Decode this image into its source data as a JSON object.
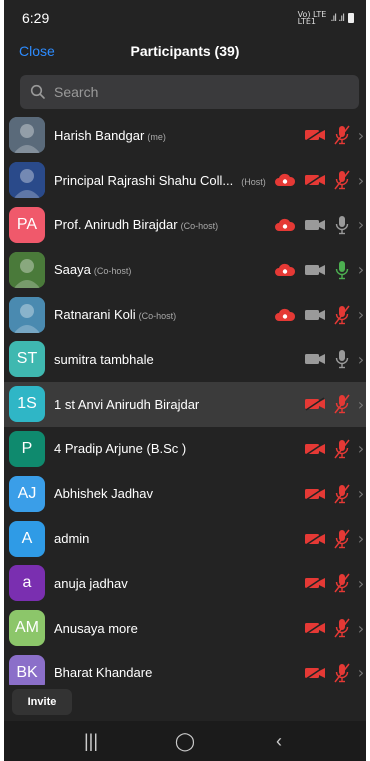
{
  "status": {
    "time": "6:29",
    "network": "Vo) LTE\nLTE1"
  },
  "header": {
    "close_label": "Close",
    "title": "Participants (39)"
  },
  "search": {
    "placeholder": "Search"
  },
  "colors": {
    "accent": "#2d8cff",
    "muted_red": "#e53935",
    "mic_green": "#4caf50"
  },
  "participants": [
    {
      "name": "Harish Bandgar",
      "tag": "(me)",
      "avatar_text": "",
      "avatar_color": "#5a6a7a",
      "avatar_photo": true,
      "cloud": false,
      "video": "off",
      "mic": "muted"
    },
    {
      "name": "Principal Rajrashi Shahu Coll...",
      "tag": "(Host)",
      "avatar_text": "",
      "avatar_color": "#2a4a8a",
      "avatar_photo": true,
      "cloud": true,
      "video": "off",
      "mic": "muted"
    },
    {
      "name": "Prof. Anirudh  Birajdar",
      "tag": "(Co-host)",
      "avatar_text": "PA",
      "avatar_color": "#f0596b",
      "avatar_photo": false,
      "cloud": true,
      "video": "on",
      "mic": "on"
    },
    {
      "name": "Saaya",
      "tag": "(Co-host)",
      "avatar_text": "",
      "avatar_color": "#4a7a3a",
      "avatar_photo": true,
      "cloud": true,
      "video": "on",
      "mic": "speaking"
    },
    {
      "name": "Ratnarani Koli",
      "tag": "(Co-host)",
      "avatar_text": "",
      "avatar_color": "#4a8ab0",
      "avatar_photo": true,
      "cloud": true,
      "video": "on",
      "mic": "muted"
    },
    {
      "name": "sumitra tambhale",
      "tag": "",
      "avatar_text": "ST",
      "avatar_color": "#3fb8b0",
      "avatar_photo": false,
      "cloud": false,
      "video": "on",
      "mic": "on"
    },
    {
      "name": "1 st Anvi Anirudh Birajdar",
      "tag": "",
      "avatar_text": "1S",
      "avatar_color": "#2fb6c6",
      "avatar_photo": false,
      "cloud": false,
      "video": "off",
      "mic": "muted"
    },
    {
      "name": "4 Pradip Arjune (B.Sc )",
      "tag": "",
      "avatar_text": "P",
      "avatar_color": "#0f8a6e",
      "avatar_photo": false,
      "cloud": false,
      "video": "off",
      "mic": "muted"
    },
    {
      "name": "Abhishek Jadhav",
      "tag": "",
      "avatar_text": "AJ",
      "avatar_color": "#3a9ee8",
      "avatar_photo": false,
      "cloud": false,
      "video": "off",
      "mic": "muted"
    },
    {
      "name": "admin",
      "tag": "",
      "avatar_text": "A",
      "avatar_color": "#2f9be6",
      "avatar_photo": false,
      "cloud": false,
      "video": "off",
      "mic": "muted"
    },
    {
      "name": "anuja jadhav",
      "tag": "",
      "avatar_text": "a",
      "avatar_color": "#7a2fb0",
      "avatar_photo": false,
      "cloud": false,
      "video": "off",
      "mic": "muted"
    },
    {
      "name": "Anusaya more",
      "tag": "",
      "avatar_text": "AM",
      "avatar_color": "#8cc66a",
      "avatar_photo": false,
      "cloud": false,
      "video": "off",
      "mic": "muted"
    },
    {
      "name": "Bharat Khandare",
      "tag": "",
      "avatar_text": "BK",
      "avatar_color": "#8b6fc9",
      "avatar_photo": false,
      "cloud": false,
      "video": "off",
      "mic": "muted"
    }
  ],
  "footer": {
    "invite_label": "Invite"
  },
  "navbar": {
    "recents": "|||",
    "home": "◯",
    "back": "‹"
  }
}
